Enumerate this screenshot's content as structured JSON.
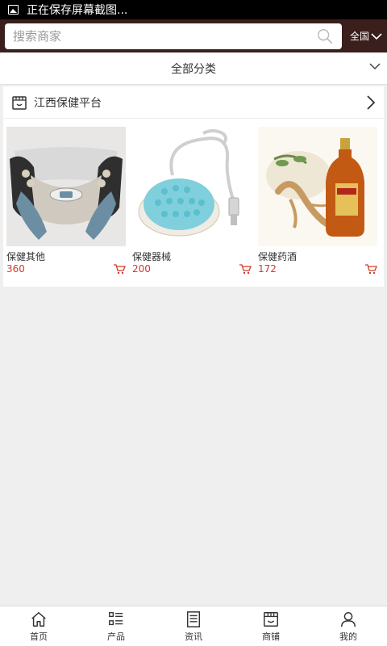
{
  "status_bar": {
    "text": "正在保存屏幕截图..."
  },
  "header": {
    "search_placeholder": "搜索商家",
    "region_label": "全国"
  },
  "category_bar": {
    "label": "全部分类"
  },
  "shop": {
    "name": "江西保健平台",
    "products": [
      {
        "name": "保健其他",
        "price": "360",
        "thumb_icon": "massager-photo"
      },
      {
        "name": "保健器械",
        "price": "200",
        "thumb_icon": "usb-massage-ball-photo"
      },
      {
        "name": "保健药酒",
        "price": "172",
        "thumb_icon": "ginseng-wine-photo"
      }
    ]
  },
  "tabbar": {
    "items": [
      {
        "label": "首页",
        "icon": "home-icon"
      },
      {
        "label": "产品",
        "icon": "list-icon"
      },
      {
        "label": "资讯",
        "icon": "news-icon"
      },
      {
        "label": "商铺",
        "icon": "shop-icon"
      },
      {
        "label": "我的",
        "icon": "user-icon"
      }
    ]
  },
  "colors": {
    "header_bg": "#3a1f1c",
    "price": "#d23a2a",
    "page_bg": "#efefef"
  }
}
